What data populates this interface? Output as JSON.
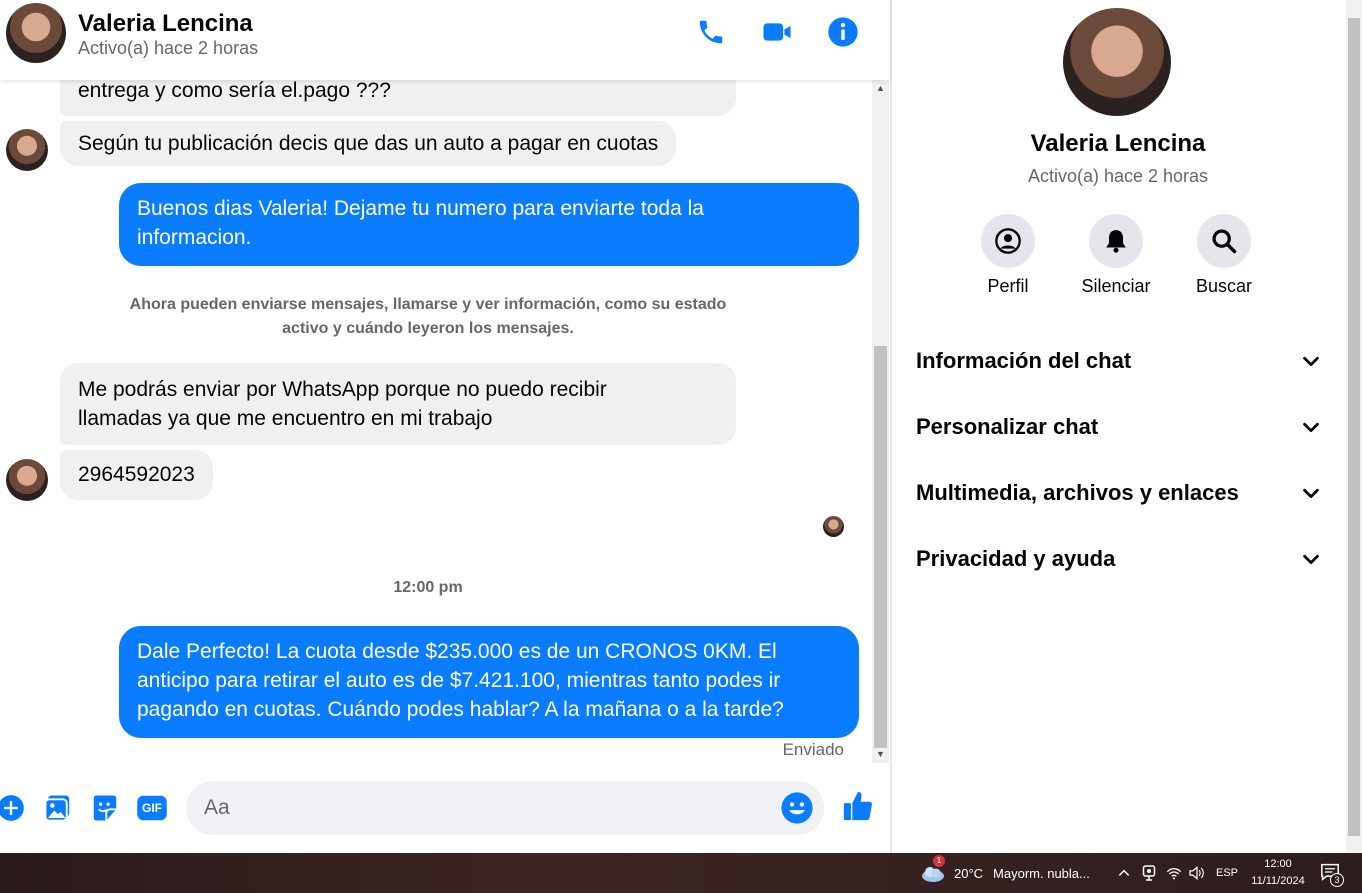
{
  "chat_header": {
    "name": "Valeria Lencina",
    "status": "Activo(a) hace 2 horas"
  },
  "messages": {
    "m1": "entrega y como sería el.pago ???",
    "m2": "Según tu publicación decis que das un auto a pagar en cuotas",
    "m3_line1": "Buenos dias Valeria! Dejame tu numero para enviarte toda la",
    "m3_line2": "informacion.",
    "system_line1": "Ahora pueden enviarse mensajes, llamarse y ver información, como su estado",
    "system_line2": "activo y cuándo leyeron los mensajes.",
    "m4_line1": "Me podrás enviar por WhatsApp porque no puedo recibir",
    "m4_line2": "llamadas ya que me encuentro en mi trabajo",
    "m5": "2964592023",
    "timestamp": "12:00 pm",
    "m6_line1": "Dale Perfecto! La cuota desde $235.000 es de un CRONOS 0KM. El",
    "m6_line2": "anticipo para retirar el auto es de $7.421.100, mientras tanto podes ir",
    "m6_line3": "pagando en cuotas. Cuándo podes hablar? A la mañana o a la tarde?",
    "sent_status": "Enviado"
  },
  "composer": {
    "placeholder": "Aa",
    "gif_label": "GIF"
  },
  "info_panel": {
    "name": "Valeria Lencina",
    "status": "Activo(a) hace 2 horas",
    "actions": [
      {
        "label": "Perfil"
      },
      {
        "label": "Silenciar"
      },
      {
        "label": "Buscar"
      }
    ],
    "sections": [
      {
        "label": "Información del chat"
      },
      {
        "label": "Personalizar chat"
      },
      {
        "label": "Multimedia, archivos y enlaces"
      },
      {
        "label": "Privacidad y ayuda"
      }
    ]
  },
  "taskbar": {
    "weather_badge": "1",
    "weather_temp": "20°C",
    "weather_text": "Mayorm. nubla...",
    "language": "ESP",
    "time": "12:00",
    "date": "11/11/2024",
    "notification_count": "3"
  },
  "colors": {
    "accent": "#0a7cff",
    "incoming_bubble": "#f0f0f0",
    "secondary_text": "#65676b"
  }
}
